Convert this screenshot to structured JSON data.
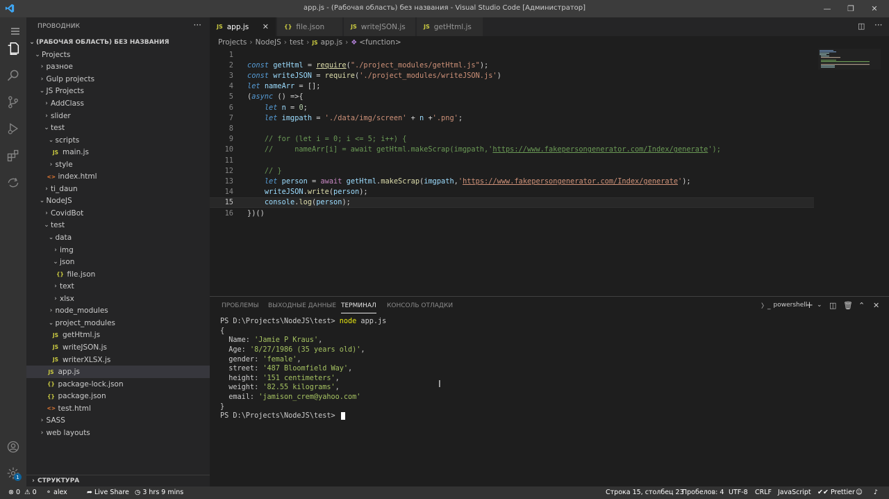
{
  "window": {
    "title": "app.js - (Рабочая область) без названия - Visual Studio Code [Администратор]"
  },
  "sidebar": {
    "header": "ПРОВОДНИК",
    "workspace": "(РАБОЧАЯ ОБЛАСТЬ) БЕЗ НАЗВАНИЯ",
    "outline": "СТРУКТУРА",
    "tree": [
      {
        "label": "Projects",
        "depth": 0,
        "type": "folder-open"
      },
      {
        "label": "разное",
        "depth": 1,
        "type": "folder"
      },
      {
        "label": "Gulp projects",
        "depth": 1,
        "type": "folder"
      },
      {
        "label": "JS Projects",
        "depth": 1,
        "type": "folder-open"
      },
      {
        "label": "AddClass",
        "depth": 2,
        "type": "folder"
      },
      {
        "label": "slider",
        "depth": 2,
        "type": "folder"
      },
      {
        "label": "test",
        "depth": 2,
        "type": "folder-open"
      },
      {
        "label": "scripts",
        "depth": 3,
        "type": "folder-open"
      },
      {
        "label": "main.js",
        "depth": 4,
        "type": "js"
      },
      {
        "label": "style",
        "depth": 3,
        "type": "folder"
      },
      {
        "label": "index.html",
        "depth": 3,
        "type": "html"
      },
      {
        "label": "ti_daun",
        "depth": 2,
        "type": "folder"
      },
      {
        "label": "NodeJS",
        "depth": 1,
        "type": "folder-open"
      },
      {
        "label": "CovidBot",
        "depth": 2,
        "type": "folder"
      },
      {
        "label": "test",
        "depth": 2,
        "type": "folder-open"
      },
      {
        "label": "data",
        "depth": 3,
        "type": "folder-open"
      },
      {
        "label": "img",
        "depth": 4,
        "type": "folder"
      },
      {
        "label": "json",
        "depth": 4,
        "type": "folder-open"
      },
      {
        "label": "file.json",
        "depth": 5,
        "type": "json"
      },
      {
        "label": "text",
        "depth": 4,
        "type": "folder"
      },
      {
        "label": "xlsx",
        "depth": 4,
        "type": "folder"
      },
      {
        "label": "node_modules",
        "depth": 3,
        "type": "folder"
      },
      {
        "label": "project_modules",
        "depth": 3,
        "type": "folder-open"
      },
      {
        "label": "getHtml.js",
        "depth": 4,
        "type": "js"
      },
      {
        "label": "writeJSON.js",
        "depth": 4,
        "type": "js"
      },
      {
        "label": "writerXLSX.js",
        "depth": 4,
        "type": "js"
      },
      {
        "label": "app.js",
        "depth": 3,
        "type": "js",
        "selected": true
      },
      {
        "label": "package-lock.json",
        "depth": 3,
        "type": "json"
      },
      {
        "label": "package.json",
        "depth": 3,
        "type": "json"
      },
      {
        "label": "test.html",
        "depth": 3,
        "type": "html"
      },
      {
        "label": "SASS",
        "depth": 1,
        "type": "folder"
      },
      {
        "label": "web layouts",
        "depth": 1,
        "type": "folder"
      }
    ]
  },
  "tabs": [
    {
      "label": "app.js",
      "icon": "JS",
      "active": true
    },
    {
      "label": "file.json",
      "icon": "{}"
    },
    {
      "label": "writeJSON.js",
      "icon": "JS"
    },
    {
      "label": "getHtml.js",
      "icon": "JS"
    }
  ],
  "breadcrumbs": [
    "Projects",
    "NodeJS",
    "test",
    "app.js",
    "<function>"
  ],
  "editor": {
    "current_line": 15,
    "lines": [
      {
        "n": "1",
        "html": ""
      },
      {
        "n": "2",
        "html": "<span class='kw'>const</span> <span class='var'>getHtml</span> <span class='op'>=</span> <span class='fn ul'>require</span><span class='op'>(</span><span class='str'>\"./project_modules/getHtml.js\"</span><span class='op'>);</span>"
      },
      {
        "n": "3",
        "html": "<span class='kw'>const</span> <span class='var'>writeJSON</span> <span class='op'>=</span> <span class='fn'>require</span><span class='op'>(</span><span class='str'>'./project_modules/writeJSON.js'</span><span class='op'>)</span>"
      },
      {
        "n": "4",
        "html": "<span class='kw'>let</span> <span class='var'>nameArr</span> <span class='op'>= [];</span>"
      },
      {
        "n": "5",
        "html": "<span class='op'>(</span><span class='kw'>async</span> <span class='op'>() =&gt;{</span>"
      },
      {
        "n": "6",
        "html": "    <span class='kw'>let</span> <span class='var'>n</span> <span class='op'>=</span> <span class='num'>0</span><span class='op'>;</span>"
      },
      {
        "n": "7",
        "html": "    <span class='kw'>let</span> <span class='var'>imgpath</span> <span class='op'>=</span> <span class='str'>'./data/img/screen'</span> <span class='op'>+</span> <span class='var'>n</span> <span class='op'>+</span><span class='str'>'.png'</span><span class='op'>;</span>"
      },
      {
        "n": "8",
        "html": ""
      },
      {
        "n": "9",
        "html": "    <span class='cm'>// for (let i = 0; i &lt;= 5; i++) {</span>"
      },
      {
        "n": "10",
        "html": "    <span class='cm'>//     nameArr[i] = await getHtml.makeScrap(imgpath,'<span class='ul'>https://www.fakepersongenerator.com/Index/generate</span>');</span>"
      },
      {
        "n": "11",
        "html": ""
      },
      {
        "n": "12",
        "html": "    <span class='cm'>// }</span>"
      },
      {
        "n": "13",
        "html": "    <span class='kw'>let</span> <span class='var'>person</span> <span class='op'>=</span> <span class='kw2'>await</span> <span class='var'>getHtml</span><span class='op'>.</span><span class='fn'>makeScrap</span><span class='op'>(</span><span class='var'>imgpath</span><span class='op'>,</span><span class='str'>'<span class='ul'>https://www.fakepersongenerator.com/Index/generate</span>'</span><span class='op'>);</span>"
      },
      {
        "n": "14",
        "html": "    <span class='var'>writeJSON</span><span class='op'>.</span><span class='fn'>write</span><span class='op'>(</span><span class='var'>person</span><span class='op'>);</span>"
      },
      {
        "n": "15",
        "html": "    <span class='var'>console</span><span class='op'>.</span><span class='fn'>log</span><span class='op'>(</span><span class='var'>person</span><span class='op'>);</span>"
      },
      {
        "n": "16",
        "html": "<span class='op'>})()</span>"
      }
    ]
  },
  "panel": {
    "tabs": [
      "ПРОБЛЕМЫ",
      "ВЫХОДНЫЕ ДАННЫЕ",
      "ТЕРМИНАЛ",
      "КОНСОЛЬ ОТЛАДКИ"
    ],
    "active_tab": "ТЕРМИНАЛ",
    "shell": "powershell",
    "terminal_lines": [
      {
        "html": "PS D:\\Projects\\NodeJS\\test&gt; <span class='tcmd'>node</span> app.js"
      },
      {
        "html": "{"
      },
      {
        "html": "  Name: <span class='tstr'>'Jamie P Kraus'</span>,"
      },
      {
        "html": "  Age: <span class='tstr'>'8/27/1986 (35 years old)'</span>,"
      },
      {
        "html": "  gender: <span class='tstr'>'female'</span>,"
      },
      {
        "html": "  street: <span class='tstr'>'487 Bloomfield Way'</span>,"
      },
      {
        "html": "  height: <span class='tstr'>'151 centimeters'</span>,"
      },
      {
        "html": "  weight: <span class='tstr'>'82.55 kilograms'</span>,"
      },
      {
        "html": "  email: <span class='tstr'>'jamison_crem@yahoo.com'</span>"
      },
      {
        "html": "}"
      },
      {
        "html": "PS D:\\Projects\\NodeJS\\test&gt; <span class='cursor'></span>"
      }
    ]
  },
  "statusbar": {
    "errors": "0",
    "warnings": "0",
    "user": "alex",
    "live_share": "Live Share",
    "time": "3 hrs 9 mins",
    "position": "Строка 15, столбец 23",
    "spaces": "Пробелов: 4",
    "encoding": "UTF-8",
    "eol": "CRLF",
    "language": "JavaScript",
    "prettier": "Prettier"
  },
  "colors": {
    "titlebar": "#3c3c3c",
    "activitybar": "#333333",
    "sidebar": "#252526",
    "editor": "#1e1e1e",
    "statusbar": "#333333"
  }
}
